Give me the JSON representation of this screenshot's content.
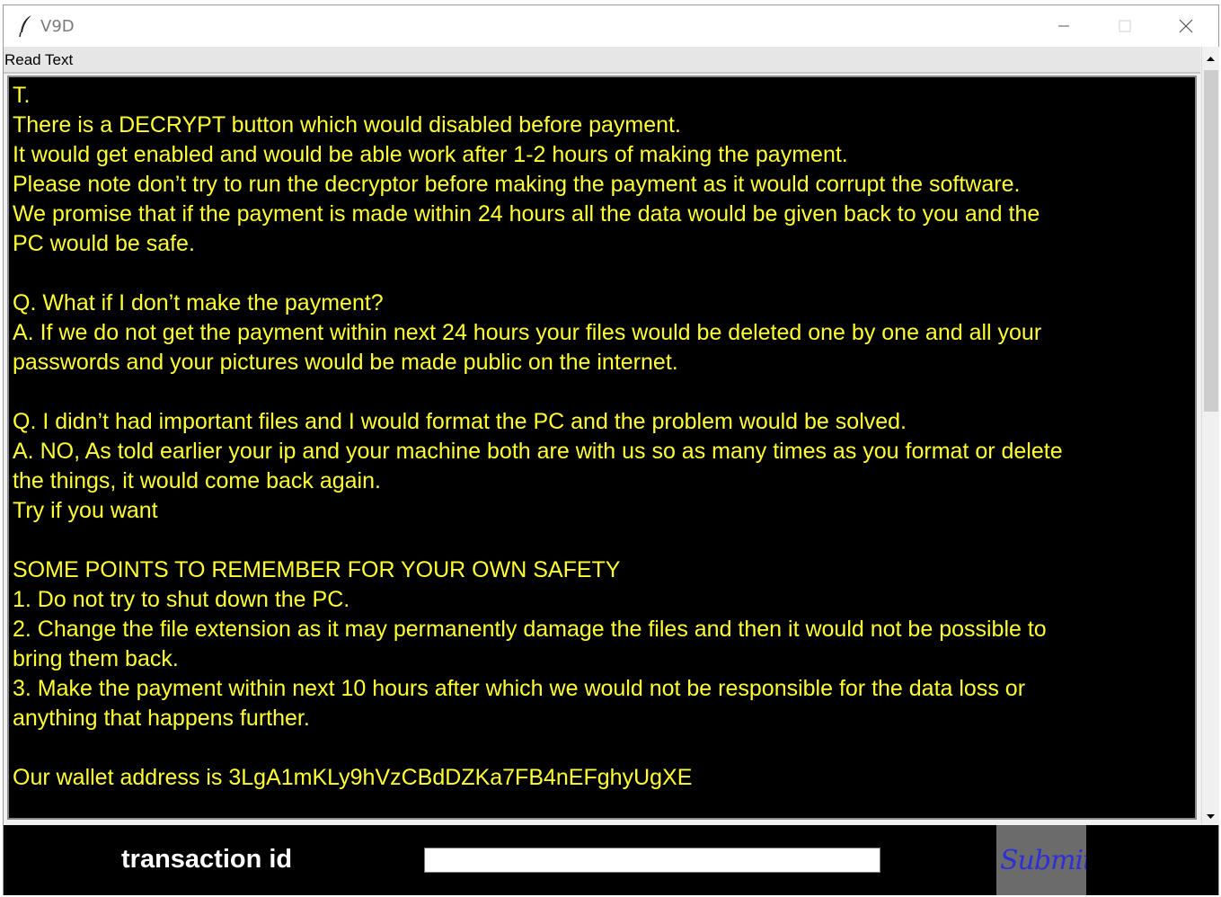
{
  "window": {
    "title": "V9D",
    "icon": "feather-icon",
    "controls": [
      "minimize-icon",
      "maximize-icon",
      "close-icon"
    ]
  },
  "menubar": {
    "label": "Read Text"
  },
  "message_lines": [
    "T.",
    "There is a DECRYPT button which would disabled before payment.",
    "It would get enabled and would be able work after 1-2 hours of making the payment.",
    "Please note don’t try to run the decryptor before making the payment as it would corrupt the software.",
    "We promise that if the payment is made within 24 hours all the data would be given back to you and the",
    "PC would be safe.",
    "",
    "Q. What if I don’t make the payment?",
    "A. If we do not get the payment within next 24 hours your files would be deleted one by one and all your",
    "passwords and your pictures would be made public on the internet.",
    "",
    "Q. I didn’t had important files and I would format the PC and the problem would be solved.",
    "A. NO, As told earlier your ip and your machine both are with us so as many times as you format or delete",
    "the things, it would come back again.",
    "Try if you want",
    "",
    "SOME POINTS TO REMEMBER FOR YOUR OWN SAFETY",
    "1. Do not try to shut down the PC.",
    "2. Change the file extension as it may permanently damage the files and then it would not be possible to",
    "bring them back.",
    "3. Make the payment within next 10 hours after which we would not be responsible for the data loss or",
    "anything that happens further.",
    "",
    "Our wallet address is 3LgA1mKLy9hVzCBdDZKa7FB4nEFghyUgXE"
  ],
  "bottom": {
    "label": "transaction id",
    "input_value": "",
    "submit_label": "Submit"
  },
  "colors": {
    "text_bg": "#000000",
    "text_fg": "#ffff33",
    "submit_bg": "#6b6b6b",
    "submit_fg": "#2f2fd6"
  }
}
